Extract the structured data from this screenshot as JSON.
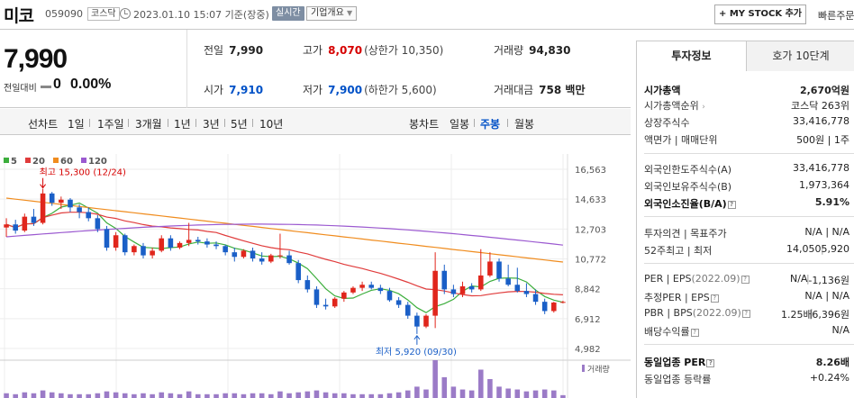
{
  "header": {
    "stock_name": "미코",
    "stock_code": "059090",
    "market": "코스닥",
    "timestamp": "2023.01.10 15:07 기준(장중)",
    "realtime": "실시간",
    "overview": "기업개요",
    "mystock_label": "MY STOCK 추가",
    "quick_order": "빠른주문"
  },
  "price": {
    "current": "7,990",
    "change_label": "전일대비",
    "change": "0",
    "change_pct": "0.00%"
  },
  "stats": {
    "prev_close_label": "전일",
    "prev_close": "7,990",
    "open_label": "시가",
    "open": "7,910",
    "high_label": "고가",
    "high": "8,070",
    "upper_limit": "(상한가 10,350)",
    "low_label": "저가",
    "low": "7,900",
    "lower_limit": "(하한가 5,600)",
    "volume_label": "거래량",
    "volume": "94,830",
    "amount_label": "거래대금",
    "amount": "758 백만"
  },
  "period_tabs": {
    "line_label": "선차트",
    "line_items": [
      "1일",
      "1주일",
      "3개월",
      "1년",
      "3년",
      "5년",
      "10년"
    ],
    "candle_label": "봉차트",
    "candle_items": [
      "일봉",
      "주봉",
      "월봉"
    ],
    "candle_active": "주봉"
  },
  "chart_data": {
    "type": "candlestick",
    "legend": [
      {
        "name": "5",
        "color": "#3cae3c"
      },
      {
        "name": "20",
        "color": "#e03c3c"
      },
      {
        "name": "60",
        "color": "#f08c1e"
      },
      {
        "name": "120",
        "color": "#9b59d0"
      }
    ],
    "y_ticks": [
      "16,563",
      "14,633",
      "12,703",
      "10,772",
      "8,842",
      "6,912",
      "4,982"
    ],
    "ylim": [
      4982,
      16563
    ],
    "high_annotation": "최고 15,300 (12/24)",
    "low_annotation": "최저 5,920 (09/30)",
    "volume_label": "거래량",
    "candles": [
      [
        12800,
        13400,
        12200,
        13000
      ],
      [
        13000,
        13300,
        12400,
        12600
      ],
      [
        12600,
        13700,
        12500,
        13500
      ],
      [
        13500,
        14000,
        12900,
        13100
      ],
      [
        13100,
        15300,
        13000,
        15000
      ],
      [
        15000,
        15100,
        14200,
        14400
      ],
      [
        14400,
        14800,
        14000,
        14600
      ],
      [
        14600,
        14700,
        13800,
        14100
      ],
      [
        14100,
        14300,
        13400,
        13800
      ],
      [
        13800,
        14100,
        13200,
        13400
      ],
      [
        13400,
        13600,
        12500,
        12700
      ],
      [
        12700,
        12900,
        11300,
        11500
      ],
      [
        11500,
        12500,
        11300,
        12300
      ],
      [
        12300,
        12400,
        11000,
        11200
      ],
      [
        11200,
        11700,
        11000,
        11600
      ],
      [
        11600,
        11800,
        10800,
        11000
      ],
      [
        11000,
        11500,
        10800,
        11300
      ],
      [
        11300,
        12300,
        11200,
        12100
      ],
      [
        12100,
        12300,
        11300,
        11500
      ],
      [
        11500,
        11900,
        11400,
        11800
      ],
      [
        11800,
        13100,
        11600,
        12000
      ],
      [
        12000,
        12200,
        11700,
        11900
      ],
      [
        11900,
        12100,
        11500,
        11700
      ],
      [
        11700,
        11900,
        11400,
        11600
      ],
      [
        11600,
        11700,
        11000,
        11200
      ],
      [
        11200,
        11500,
        10600,
        10900
      ],
      [
        10900,
        11400,
        10800,
        11300
      ],
      [
        11300,
        11500,
        10600,
        10800
      ],
      [
        10800,
        11200,
        10400,
        10600
      ],
      [
        10600,
        11100,
        10500,
        11000
      ],
      [
        11000,
        12400,
        10800,
        11000
      ],
      [
        11000,
        11300,
        10400,
        10500
      ],
      [
        10500,
        10700,
        9200,
        9400
      ],
      [
        9400,
        9700,
        8600,
        8800
      ],
      [
        8800,
        9000,
        7600,
        7800
      ],
      [
        7800,
        8200,
        7500,
        7700
      ],
      [
        7700,
        8300,
        7600,
        8200
      ],
      [
        8200,
        8700,
        8000,
        8600
      ],
      [
        8600,
        9000,
        8500,
        8900
      ],
      [
        8900,
        9300,
        8700,
        9100
      ],
      [
        9100,
        9300,
        8800,
        8900
      ],
      [
        8900,
        9100,
        8500,
        8700
      ],
      [
        8700,
        8900,
        8000,
        8100
      ],
      [
        8100,
        8300,
        7600,
        7800
      ],
      [
        7800,
        8000,
        6900,
        7100
      ],
      [
        7100,
        7300,
        5920,
        6400
      ],
      [
        6400,
        7200,
        6300,
        7100
      ],
      [
        7100,
        11200,
        6300,
        10000
      ],
      [
        10000,
        10400,
        8500,
        8800
      ],
      [
        8800,
        9100,
        8300,
        8500
      ],
      [
        8500,
        9300,
        8300,
        9000
      ],
      [
        9000,
        9200,
        8600,
        8800
      ],
      [
        8800,
        11400,
        8700,
        9700
      ],
      [
        9700,
        11200,
        9600,
        10600
      ],
      [
        10600,
        10800,
        9300,
        9500
      ],
      [
        9500,
        10400,
        9000,
        9100
      ],
      [
        9100,
        10200,
        8600,
        8700
      ],
      [
        8700,
        9200,
        8300,
        8500
      ],
      [
        8500,
        8800,
        7800,
        8000
      ],
      [
        8000,
        8200,
        7200,
        7400
      ],
      [
        7400,
        8000,
        7300,
        7950
      ],
      [
        7950,
        8070,
        7900,
        7990
      ]
    ],
    "volumes": [
      5,
      4,
      6,
      5,
      8,
      6,
      5,
      4,
      4,
      4,
      5,
      7,
      6,
      5,
      4,
      5,
      4,
      6,
      5,
      4,
      7,
      4,
      4,
      4,
      5,
      5,
      4,
      5,
      5,
      4,
      7,
      5,
      6,
      7,
      8,
      6,
      5,
      5,
      4,
      4,
      4,
      4,
      5,
      6,
      8,
      12,
      9,
      40,
      22,
      12,
      9,
      8,
      30,
      20,
      12,
      10,
      9,
      7,
      8,
      9,
      8,
      3
    ]
  },
  "invest": {
    "tab1": "투자정보",
    "tab2": "호가 10단계",
    "rows": {
      "mcap_k": "시가총액",
      "mcap_v": "2,670억원",
      "mcap_rank_k": "시가총액순위",
      "mcap_rank_v": "코스닥 263위",
      "shares_k": "상장주식수",
      "shares_v": "33,416,778",
      "par_k": "액면가 | 매매단위",
      "par_v": "500원 | 1주",
      "foreign_limit_k": "외국인한도주식수(A)",
      "foreign_limit_v": "33,416,778",
      "foreign_hold_k": "외국인보유주식수(B)",
      "foreign_hold_v": "1,973,364",
      "foreign_rate_k": "외국인소진율(B/A)",
      "foreign_rate_v": "5.91%",
      "opinion_k": "투자의견 | 목표주가",
      "opinion_v": "N/A | N/A",
      "wk52_k": "52주최고 | 최저",
      "wk52_v1": "14,050",
      "wk52_v2": "5,920",
      "per_k": "PER | EPS",
      "per_year": "(2022.09)",
      "per_v1": "N/A",
      "per_v2": "-1,136원",
      "est_k": "추정PER | EPS",
      "est_v": "N/A | N/A",
      "pbr_k": "PBR | BPS",
      "pbr_year": "(2022.09)",
      "pbr_v1": "1.25배",
      "pbr_v2": "6,396원",
      "div_k": "배당수익률",
      "div_v": "N/A",
      "ind_per_k": "동일업종 PER",
      "ind_per_v": "8.26배",
      "ind_rate_k": "동일업종 등락률",
      "ind_rate_v": "+0.24%"
    }
  }
}
